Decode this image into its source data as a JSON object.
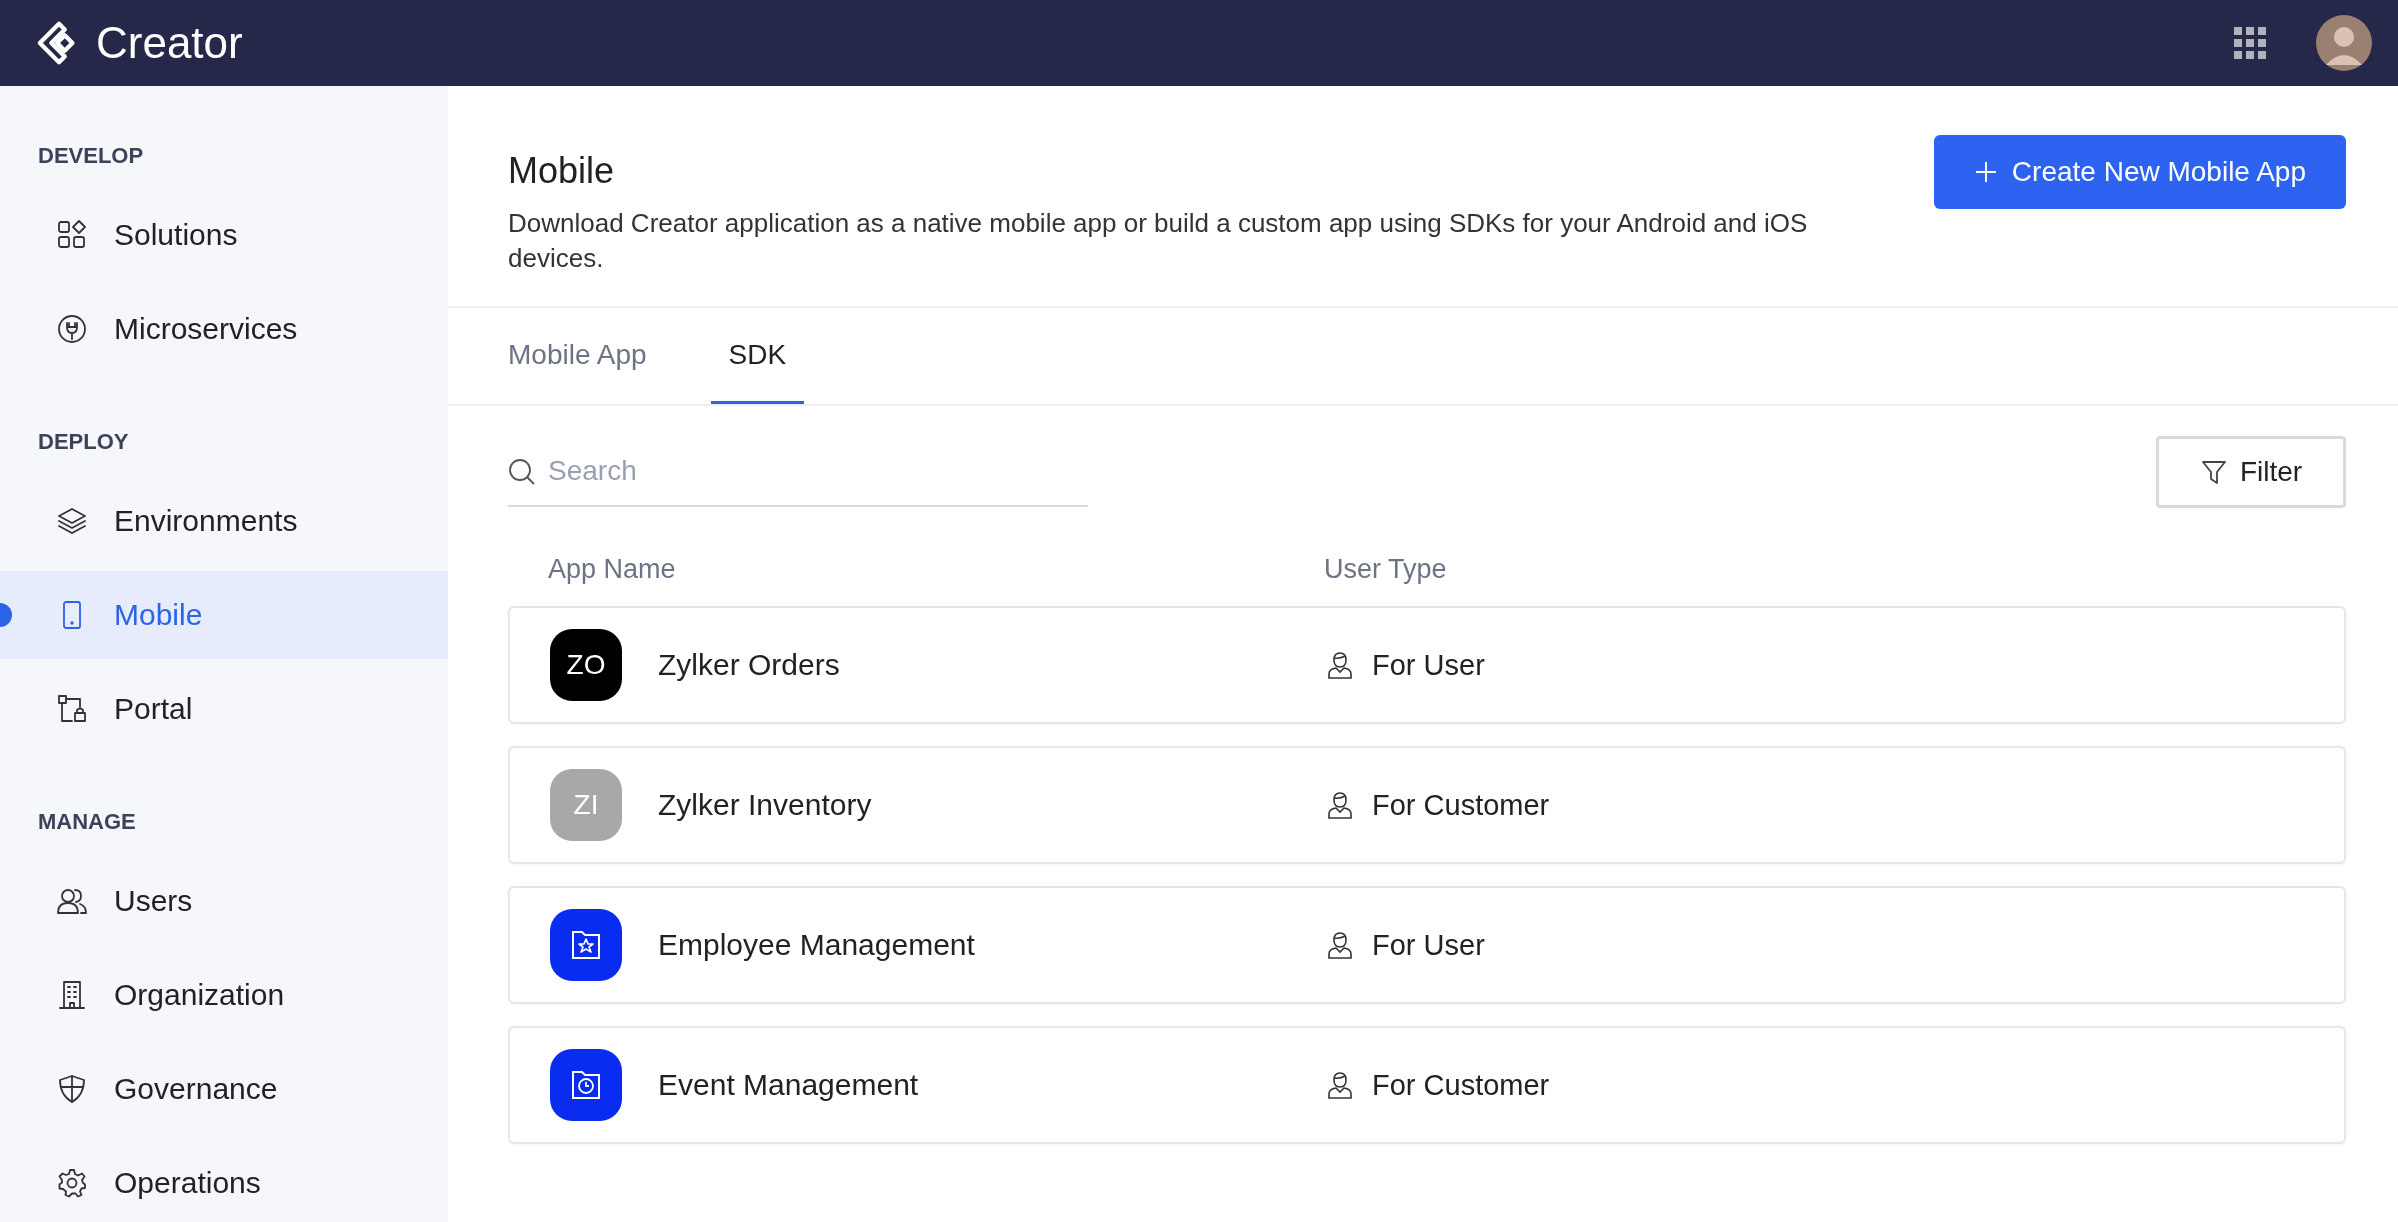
{
  "header": {
    "logo_text": "Creator"
  },
  "sidebar": {
    "sections": [
      {
        "heading": "DEVELOP",
        "items": [
          {
            "label": "Solutions",
            "selected": false
          },
          {
            "label": "Microservices",
            "selected": false
          }
        ]
      },
      {
        "heading": "DEPLOY",
        "items": [
          {
            "label": "Environments",
            "selected": false
          },
          {
            "label": "Mobile",
            "selected": true
          },
          {
            "label": "Portal",
            "selected": false
          }
        ]
      },
      {
        "heading": "MANAGE",
        "items": [
          {
            "label": "Users",
            "selected": false
          },
          {
            "label": "Organization",
            "selected": false
          },
          {
            "label": "Governance",
            "selected": false
          },
          {
            "label": "Operations",
            "selected": false
          }
        ]
      }
    ]
  },
  "page": {
    "title": "Mobile",
    "description": "Download Creator application as a native mobile app or build a custom app using SDKs for your Android and iOS devices.",
    "create_button": "Create New Mobile App"
  },
  "tabs": [
    {
      "label": "Mobile App",
      "selected": false
    },
    {
      "label": "SDK",
      "selected": true
    }
  ],
  "search": {
    "placeholder": "Search"
  },
  "filter_button": "Filter",
  "table": {
    "columns": [
      "App Name",
      "User Type"
    ],
    "rows": [
      {
        "kind": "initials",
        "initials": "ZO",
        "color": "#000000",
        "name": "Zylker Orders",
        "user_type": "For User"
      },
      {
        "kind": "initials",
        "initials": "ZI",
        "color": "#a8a8a8",
        "name": "Zylker Inventory",
        "user_type": "For Customer"
      },
      {
        "kind": "folder-star",
        "color": "#0a2cf0",
        "name": "Employee Management",
        "user_type": "For User"
      },
      {
        "kind": "folder-clock",
        "color": "#0a2cf0",
        "name": "Event Management",
        "user_type": "For Customer"
      }
    ]
  }
}
